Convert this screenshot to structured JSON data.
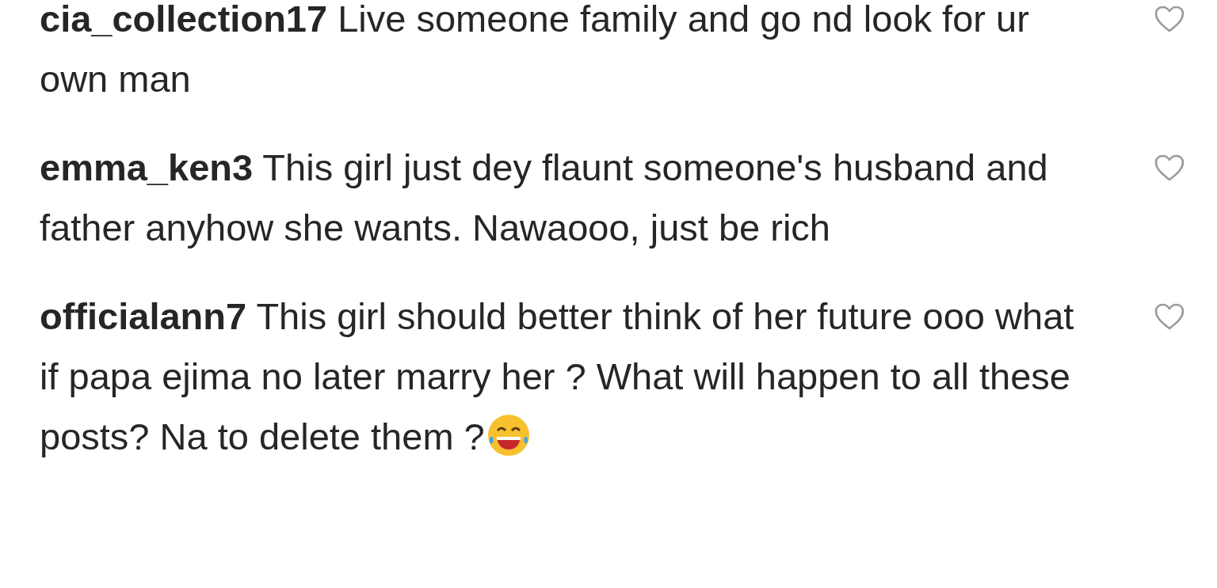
{
  "comments": [
    {
      "username": "cia_collection17",
      "text": "Live someone family and go nd look for ur own man",
      "liked": false
    },
    {
      "username": "emma_ken3",
      "text": "This girl just dey flaunt someone's husband and father anyhow she wants. Nawaooo, just be rich",
      "liked": false
    },
    {
      "username": "officialann7",
      "text": "This girl should better think of her future ooo what if papa ejima no later marry her ? What will happen to all these posts? Na to delete them ?",
      "liked": false
    }
  ]
}
